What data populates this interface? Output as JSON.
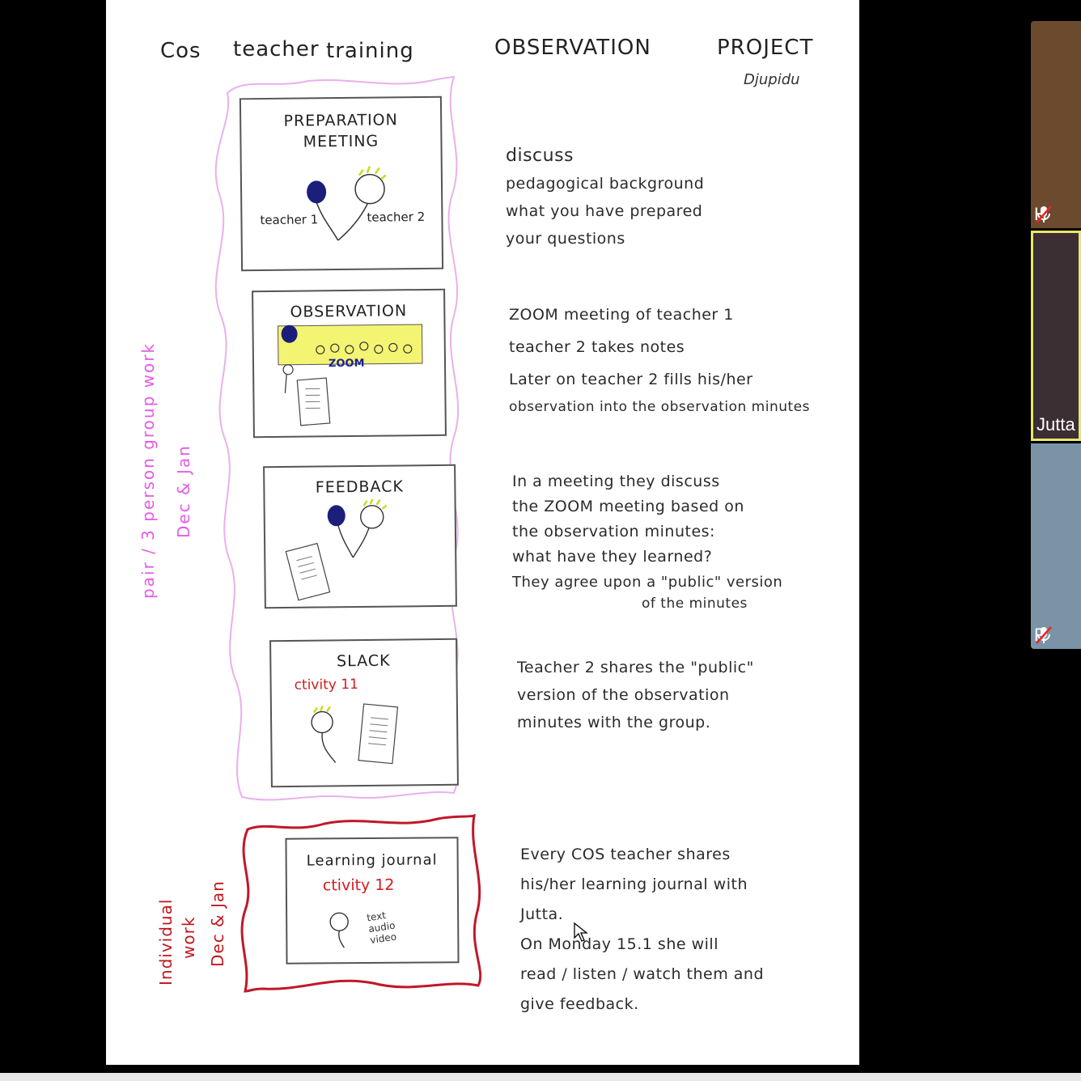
{
  "document": {
    "title": {
      "left1": "Cos",
      "left2": "teacher",
      "left3": "training",
      "right1": "OBSERVATION",
      "right2": "PROJECT",
      "signature": "Djupidu"
    },
    "steps": [
      {
        "title_line1": "PREPARATION",
        "title_line2": "MEETING",
        "label_a": "teacher 1",
        "label_b": "teacher 2",
        "notes": [
          "discuss",
          "pedagogical background",
          "what you have prepared",
          "your questions"
        ]
      },
      {
        "title": "OBSERVATION",
        "screen_label": "ZOOM",
        "notes": [
          "ZOOM meeting of teacher 1",
          "teacher 2 takes notes",
          "Later on teacher 2 fills his/her",
          "observation into the observation minutes"
        ]
      },
      {
        "title": "FEEDBACK",
        "notes": [
          "In a meeting they discuss",
          "the ZOOM meeting based on",
          "the observation minutes:",
          "what have they learned?",
          "They agree upon a \"public\" version",
          "of the minutes"
        ]
      },
      {
        "title": "SLACK",
        "activity": "ctivity 11",
        "notes": [
          "Teacher 2 shares the \"public\"",
          "version of the observation",
          "minutes with the group."
        ]
      },
      {
        "title": "Learning journal",
        "activity": "ctivity 12",
        "media": [
          "text",
          "audio",
          "video"
        ],
        "notes": [
          "Every COS teacher shares",
          "his/her learning journal with",
          "Jutta.",
          "On Monday 15.1 she will",
          "read / listen / watch them and",
          "give feedback."
        ]
      }
    ],
    "side_labels": {
      "group_line1": "pair / 3 person group work",
      "group_line2": "Dec & Jan",
      "individual_line1": "Individual",
      "individual_line2": "work",
      "individual_line3": "Dec & Jan"
    }
  },
  "participants": [
    {
      "name": "H",
      "muted": true,
      "bg": "#6b4a2e"
    },
    {
      "name": "Jutta",
      "muted": false,
      "bg": "#3b2f33",
      "active": true,
      "border": "#e9e66a"
    },
    {
      "name": "R",
      "muted": true,
      "bg": "#7a93a6"
    }
  ]
}
